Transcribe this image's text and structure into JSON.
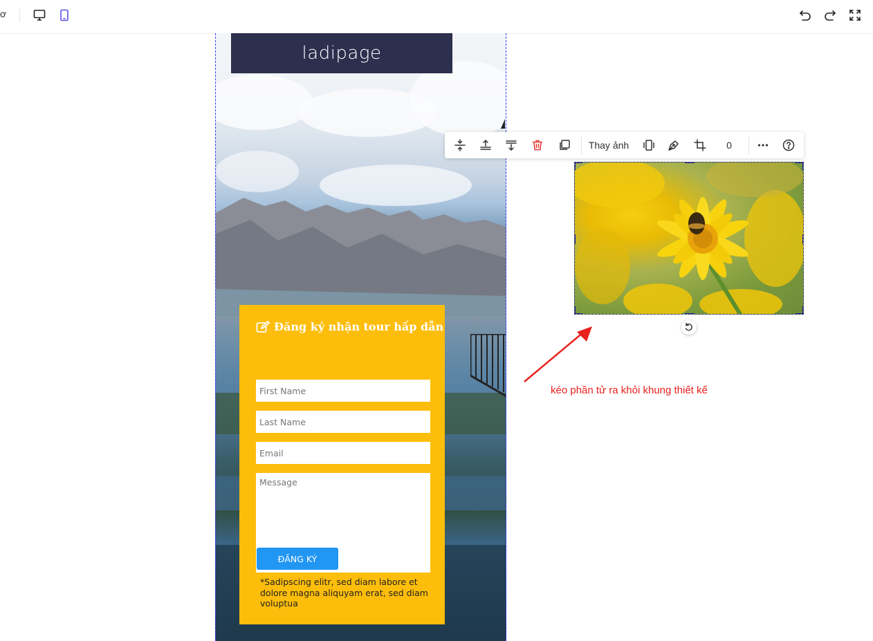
{
  "topbar": {
    "cut_label": "ơ",
    "icons": [
      "desktop-icon",
      "mobile-icon",
      "undo-icon",
      "redo-icon",
      "fullscreen-icon"
    ],
    "active_color": "#5b4ee6"
  },
  "canvas": {
    "logo_text": "ladipage",
    "logo_bg": "#2d2f4f"
  },
  "form": {
    "title": "Đăng ký nhận tour hấp dẫn",
    "bg_color": "#fdbd0b",
    "first_name_placeholder": "First Name",
    "last_name_placeholder": "Last Name",
    "email_placeholder": "Email",
    "message_placeholder": "Message",
    "submit_label": "ĐĂNG KÝ",
    "submit_color": "#2196f3",
    "note": "*Sadipscing elitr, sed diam labore et dolore magna aliquyam erat, sed diam voluptua"
  },
  "toolbar": {
    "replace_image_label": "Thay ảnh",
    "counter_value": "0",
    "delete_color": "#e53935"
  },
  "annotation": {
    "text": "kéo phần tử ra khỏi khung thiết kế",
    "color": "#e8211c"
  }
}
